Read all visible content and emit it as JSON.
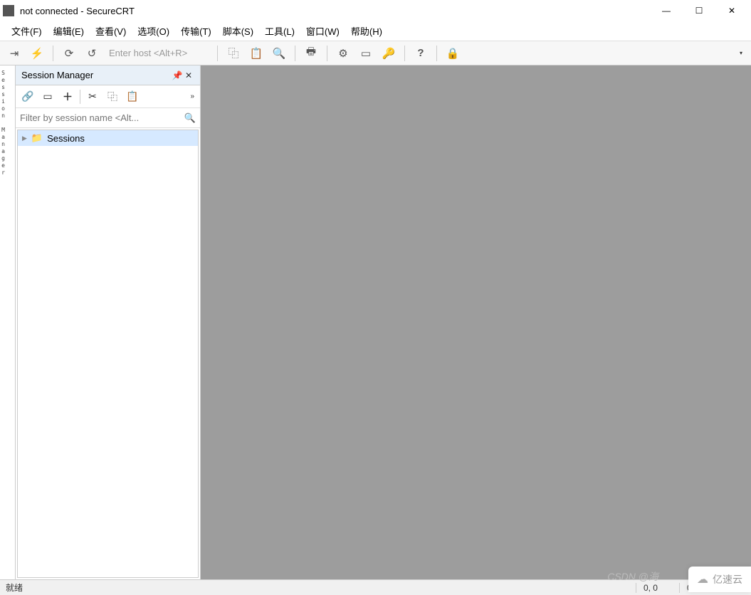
{
  "window": {
    "title": "not connected - SecureCRT"
  },
  "menu": {
    "file": "文件(F)",
    "edit": "编辑(E)",
    "view": "查看(V)",
    "options": "选项(O)",
    "transfer": "传输(T)",
    "script": "脚本(S)",
    "tools": "工具(L)",
    "window": "窗口(W)",
    "help": "帮助(H)"
  },
  "toolbar": {
    "host_placeholder": "Enter host <Alt+R>"
  },
  "sidebar_tab": "Session Manager",
  "panel": {
    "title": "Session Manager",
    "filter_placeholder": "Filter by session name <Alt...",
    "root_node": "Sessions"
  },
  "status": {
    "ready": "就绪",
    "pos": "0, 0",
    "rows": "0 Rows, 0 Co"
  },
  "watermark": {
    "csdn": "CSDN @海",
    "yisu": "亿速云"
  }
}
